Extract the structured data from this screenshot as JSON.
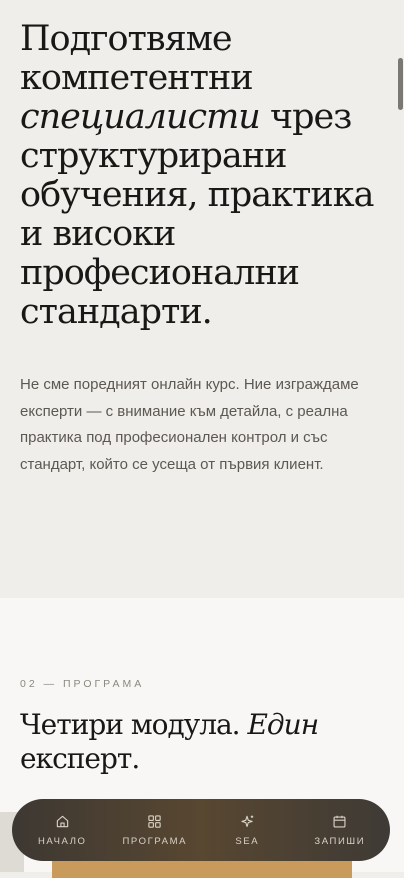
{
  "hero": {
    "headline_part1": "Подготвяме компетентни ",
    "headline_emphasis": "специалисти",
    "headline_part2": " чрез структурирани обучения, практика и високи професионални стандарти.",
    "lead": "Не сме поредният онлайн курс. Ние изграждаме експерти — с внимание към детайла, с реална практика под професионален контрол и със стандарт, който се усеща от първия клиент."
  },
  "program": {
    "eyebrow": "02 — ПРОГРАМА",
    "title_part1": "Четири модула. ",
    "title_emphasis": "Един",
    "title_part2": " експерт."
  },
  "tabbar": {
    "items": [
      {
        "label": "НАЧАЛО",
        "icon": "home-icon"
      },
      {
        "label": "ПРОГРАМА",
        "icon": "grid-icon"
      },
      {
        "label": "SEA",
        "icon": "sparkle-icon"
      },
      {
        "label": "ЗАПИШИ",
        "icon": "calendar-icon"
      }
    ]
  },
  "colors": {
    "hero_background": "#f0eeea",
    "section_background": "#f8f7f5",
    "text_primary": "#1a1816",
    "text_secondary": "#5c5852",
    "tabbar_background": "#4a4036",
    "tab_label": "#d9d2c6"
  }
}
